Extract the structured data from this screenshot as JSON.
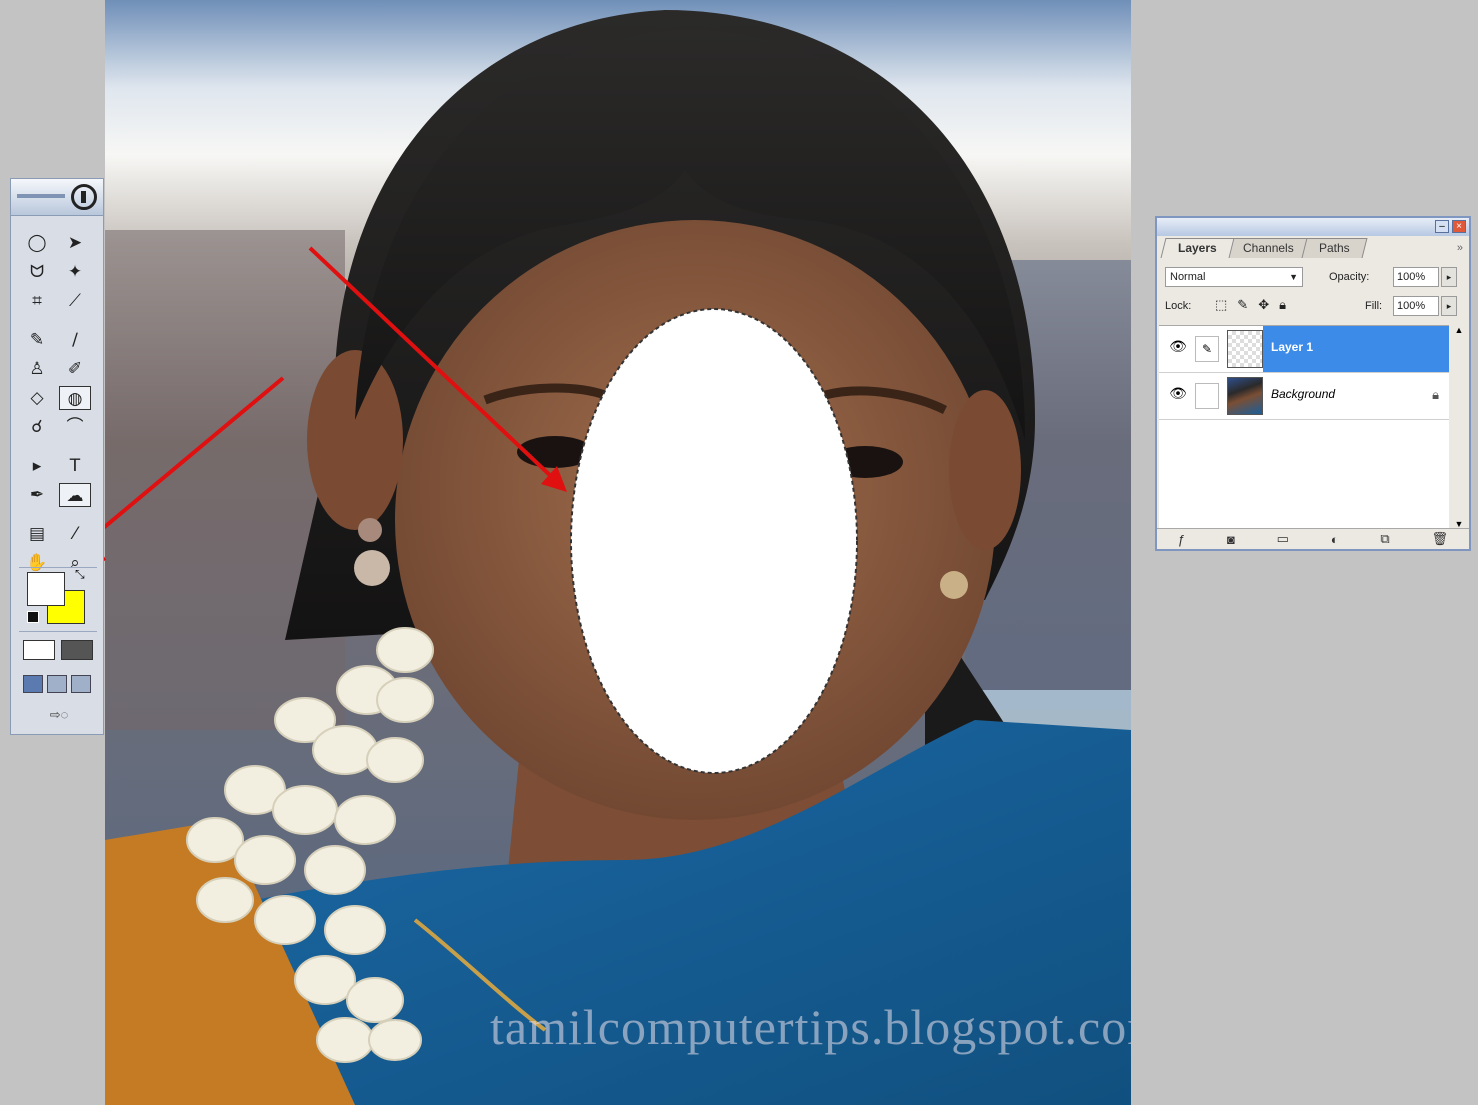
{
  "watermark": "tamilcomputertips.blogspot.com",
  "toolbox": {
    "tools": [
      {
        "name": "elliptical-marquee-icon",
        "glyph": "◯"
      },
      {
        "name": "move-icon",
        "glyph": "➤"
      },
      {
        "name": "lasso-icon",
        "glyph": "ᗢ"
      },
      {
        "name": "magic-wand-icon",
        "glyph": "✦"
      },
      {
        "name": "crop-icon",
        "glyph": "⌗"
      },
      {
        "name": "slice-icon",
        "glyph": "⟋"
      },
      {
        "name": "healing-brush-icon",
        "glyph": "✎"
      },
      {
        "name": "brush-icon",
        "glyph": "∕"
      },
      {
        "name": "clone-stamp-icon",
        "glyph": "♙"
      },
      {
        "name": "history-brush-icon",
        "glyph": "✐"
      },
      {
        "name": "eraser-icon",
        "glyph": "◇"
      },
      {
        "name": "paint-bucket-icon",
        "glyph": "◍"
      },
      {
        "name": "blur-icon",
        "glyph": "☌"
      },
      {
        "name": "dodge-icon",
        "glyph": "⌒"
      },
      {
        "name": "path-selection-icon",
        "glyph": "▸"
      },
      {
        "name": "type-tool-icon",
        "glyph": "T"
      },
      {
        "name": "pen-tool-icon",
        "glyph": "✒"
      },
      {
        "name": "custom-shape-icon",
        "glyph": "☁"
      },
      {
        "name": "notes-icon",
        "glyph": "▤"
      },
      {
        "name": "eyedropper-icon",
        "glyph": "⁄"
      },
      {
        "name": "hand-tool-icon",
        "glyph": "✋"
      },
      {
        "name": "zoom-tool-icon",
        "glyph": "⌕"
      }
    ],
    "foreground_color": "#ffffff",
    "background_color": "#ffff00"
  },
  "layers_panel": {
    "tabs": [
      "Layers",
      "Channels",
      "Paths"
    ],
    "blend_mode": "Normal",
    "opacity_label": "Opacity:",
    "opacity_value": "100%",
    "lock_label": "Lock:",
    "fill_label": "Fill:",
    "fill_value": "100%",
    "layers": [
      {
        "name": "Layer 1",
        "selected": true
      },
      {
        "name": "Background",
        "selected": false
      }
    ]
  },
  "colors": {
    "selection_fill": "#ffffff",
    "arrow": "#e01010",
    "layer_highlight": "#3d8be8"
  }
}
